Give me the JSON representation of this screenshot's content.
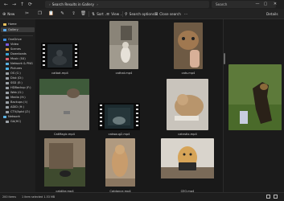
{
  "address": {
    "chevron": "›",
    "path": "Search Results in Gallery",
    "chevron_after": "›"
  },
  "search": {
    "placeholder": "Search"
  },
  "nav": {
    "back": "←",
    "forward": "→",
    "up": "↑",
    "refresh": "⟳"
  },
  "window_controls": {
    "minimize": "—",
    "maximize": "▢",
    "close": "✕"
  },
  "toolbar": {
    "new_label": "New",
    "sort_label": "Sort",
    "view_label": "View",
    "search_options_label": "Search options",
    "close_search_label": "Close search",
    "more_label": "···",
    "details_label": "Details"
  },
  "sidebar": {
    "items": [
      {
        "label": "Home",
        "color": "#e8c15c"
      },
      {
        "label": "Gallery",
        "color": "#5aa7e8"
      },
      {
        "label": "OneDrive",
        "color": "#3e8fe0"
      },
      {
        "label": "Video",
        "color": "#7a5ae0"
      },
      {
        "label": "Scenes",
        "color": "#e0a040"
      },
      {
        "label": "Downloads",
        "color": "#3aa4d8"
      },
      {
        "label": "Music (S4)",
        "color": "#e06070"
      },
      {
        "label": "Network & PNG",
        "color": "#5ab0e0"
      },
      {
        "label": "Pictures",
        "color": "#4fb3e6"
      },
      {
        "label": "OS (C:)",
        "color": "#9aa0a6"
      },
      {
        "label": "Disk (D:)",
        "color": "#9aa0a6"
      },
      {
        "label": "SSD (E:)",
        "color": "#9aa0a6"
      },
      {
        "label": "HDBackup (F:)",
        "color": "#9aa0a6"
      },
      {
        "label": "Web (G:)",
        "color": "#9aa0a6"
      },
      {
        "label": "Media (H:)",
        "color": "#9aa0a6"
      },
      {
        "label": "Backups (I:)",
        "color": "#9aa0a6"
      },
      {
        "label": "ADID (H:)",
        "color": "#9aa0a6"
      },
      {
        "label": "CTV/Aptd (Z:)",
        "color": "#9aa0a6"
      },
      {
        "label": "Network",
        "color": "#5ab0e0"
      },
      {
        "label": "GA(HC)",
        "color": "#9aa0a6"
      }
    ]
  },
  "files": [
    {
      "name": "catbat.mp4"
    },
    {
      "name": "cathat.mp4"
    },
    {
      "name": "cats.mp4"
    },
    {
      "name": "CatMagic.mp4"
    },
    {
      "name": "catwoug2.mp4"
    },
    {
      "name": "catnstix.mp4"
    },
    {
      "name": "catdike.mp4"
    },
    {
      "name": "Catdance.mp4"
    },
    {
      "name": "CEO.mp4"
    }
  ],
  "status": {
    "count": "200 items",
    "selected": "1 item selected  1.53 MB"
  },
  "colors": {
    "background": "#191919",
    "accent": "#5aa7e8"
  }
}
